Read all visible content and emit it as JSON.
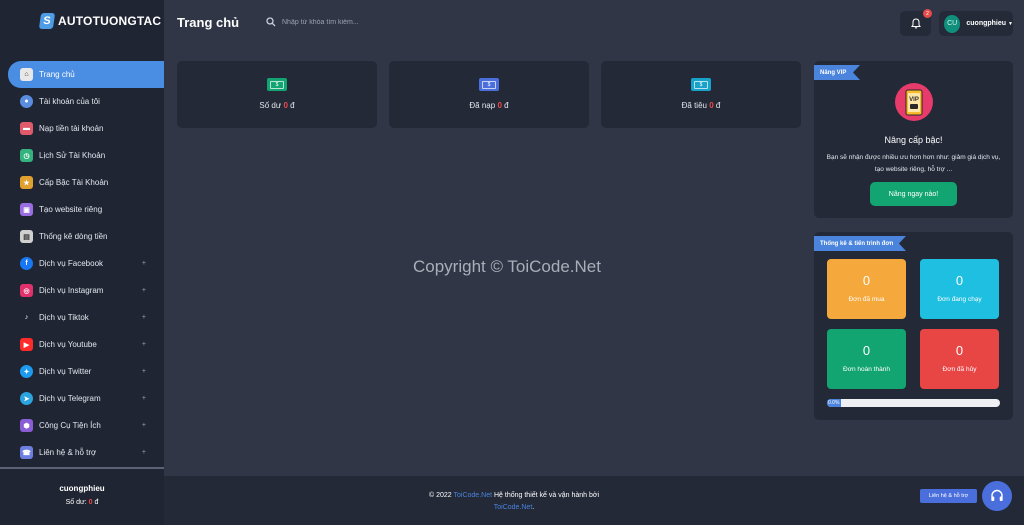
{
  "brand": {
    "name": "AUTOTUONGTAC"
  },
  "header": {
    "title": "Trang chủ",
    "search_placeholder": "Nhập từ khóa tìm kiếm...",
    "notification_count": "2",
    "user_initials": "CU",
    "user_name": "cuongphieu"
  },
  "sidebar": {
    "items": [
      {
        "label": "Trang chủ",
        "icon": "bank-icon",
        "active": true
      },
      {
        "label": "Tài khoản của tôi",
        "icon": "user-icon"
      },
      {
        "label": "Nạp tiền tài khoản",
        "icon": "credit-card-icon"
      },
      {
        "label": "Lịch Sử Tài Khoản",
        "icon": "history-icon"
      },
      {
        "label": "Cấp Bậc Tài Khoản",
        "icon": "rank-icon"
      },
      {
        "label": "Tạo website riêng",
        "icon": "website-icon"
      },
      {
        "label": "Thống kê dòng tiền",
        "icon": "stats-icon"
      },
      {
        "label": "Dịch vụ Facebook",
        "icon": "facebook-icon",
        "arrow": "+"
      },
      {
        "label": "Dịch vụ Instagram",
        "icon": "instagram-icon",
        "arrow": "+"
      },
      {
        "label": "Dịch vụ Tiktok",
        "icon": "tiktok-icon",
        "arrow": "+"
      },
      {
        "label": "Dịch vụ Youtube",
        "icon": "youtube-icon",
        "arrow": "+"
      },
      {
        "label": "Dịch vụ Twitter",
        "icon": "twitter-icon",
        "arrow": "+"
      },
      {
        "label": "Dịch vụ Telegram",
        "icon": "telegram-icon",
        "arrow": "+"
      },
      {
        "label": "Công Cụ Tiện Ích",
        "icon": "tools-icon",
        "arrow": "+"
      },
      {
        "label": "Liên hệ & hỗ trợ",
        "icon": "support-icon",
        "arrow": "+"
      }
    ],
    "user_name": "cuongphieu",
    "balance_label": "Số dư:",
    "balance_value": "0",
    "balance_unit": "đ"
  },
  "stats": [
    {
      "label": "Số dư",
      "value": "0",
      "unit": "đ",
      "icon_color": "#12a572"
    },
    {
      "label": "Đã nạp",
      "value": "0",
      "unit": "đ",
      "icon_color": "#4a6fdc"
    },
    {
      "label": "Đã tiêu",
      "value": "0",
      "unit": "đ",
      "icon_color": "#17a2c9"
    }
  ],
  "watermark": "Copyright © ToiCode.Net",
  "vip": {
    "ribbon": "Nâng VIP",
    "icon_text": "VIP",
    "title": "Nâng cấp bậc!",
    "desc_line1": "Bạn sẽ nhận được nhiều ưu hơn hơn như: giảm giá dịch vụ,",
    "desc_line2": "tạo website riêng, hỗ trợ ...",
    "button": "Nâng ngay nào!"
  },
  "orders": {
    "ribbon": "Thống kê & tiến trình đơn",
    "tiles": [
      {
        "value": "0",
        "label": "Đơn đã mua",
        "color": "#f5a83c"
      },
      {
        "value": "0",
        "label": "Đơn đang chạy",
        "color": "#1ebfe0"
      },
      {
        "value": "0",
        "label": "Đơn hoàn thành",
        "color": "#12a572"
      },
      {
        "value": "0",
        "label": "Đơn đã hủy",
        "color": "#e84545"
      }
    ],
    "progress_percent": 8,
    "progress_label": "0.0%"
  },
  "footer": {
    "prefix": "© 2022",
    "brand": "ToiCode.Net",
    "middle": "Hệ thống thiết kế và vận hành bởi",
    "brand2": "ToiCode.Net",
    "suffix": ".",
    "support_button": "Liên hệ & hỗ trợ"
  }
}
